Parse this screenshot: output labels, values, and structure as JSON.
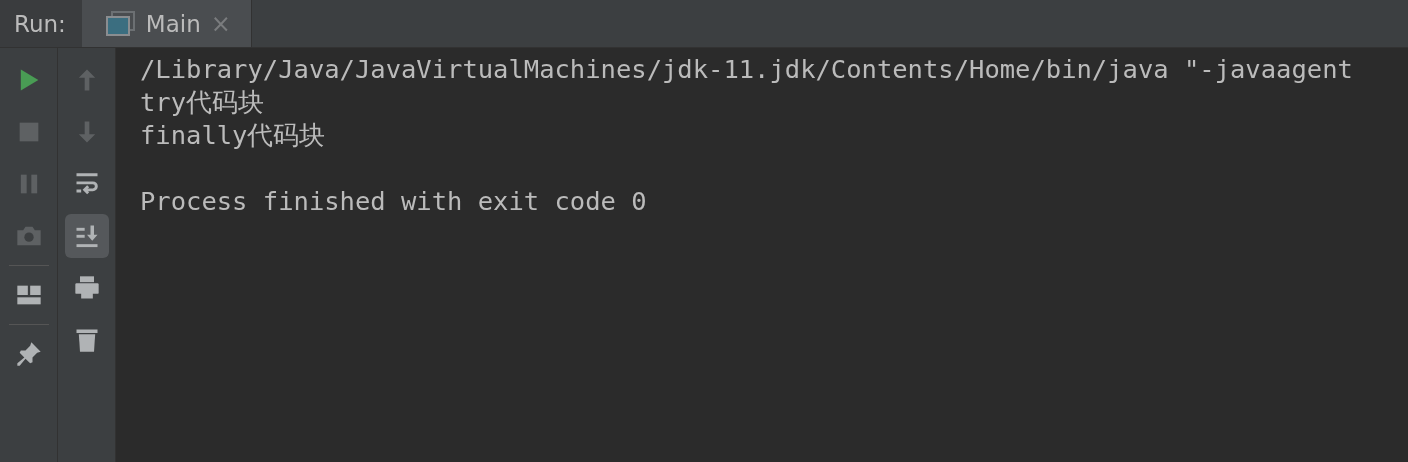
{
  "run_label": "Run:",
  "tabs": [
    {
      "label": "Main",
      "selected": true,
      "close": "×"
    }
  ],
  "toolbar_primary": [
    {
      "kind": "run",
      "disabled": false
    },
    {
      "kind": "stop",
      "disabled": true
    },
    {
      "kind": "pause",
      "disabled": true
    },
    {
      "kind": "camera",
      "disabled": true
    },
    {
      "kind": "layout",
      "disabled": false,
      "separator": true
    },
    {
      "kind": "pin",
      "disabled": false,
      "separator": true
    }
  ],
  "toolbar_secondary": [
    {
      "kind": "up",
      "disabled": true,
      "selected": false
    },
    {
      "kind": "down",
      "disabled": true,
      "selected": false
    },
    {
      "kind": "wrap",
      "disabled": false,
      "selected": false
    },
    {
      "kind": "scroll-end",
      "disabled": false,
      "selected": true
    },
    {
      "kind": "print",
      "disabled": false,
      "selected": false
    },
    {
      "kind": "trash",
      "disabled": false,
      "selected": false
    }
  ],
  "console_lines": [
    {
      "text": "/Library/Java/JavaVirtualMachines/jdk-11.jdk/Contents/Home/bin/java \"-javaagent",
      "spaced": false
    },
    {
      "text": "try代码块",
      "spaced": false
    },
    {
      "text": "finally代码块",
      "spaced": false
    },
    {
      "text": "Process finished with exit code 0",
      "spaced": true
    }
  ]
}
